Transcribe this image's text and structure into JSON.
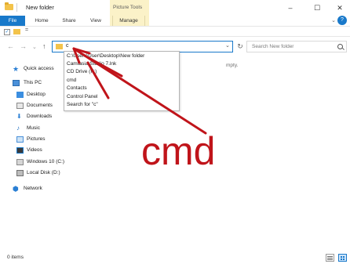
{
  "window": {
    "title": "New folder",
    "contextual_group": "Picture Tools",
    "controls": {
      "minimize": "–",
      "maximize": "☐",
      "close": "✕"
    }
  },
  "ribbon": {
    "tabs": [
      {
        "label": "File"
      },
      {
        "label": "Home"
      },
      {
        "label": "Share"
      },
      {
        "label": "View"
      },
      {
        "label": "Manage"
      }
    ],
    "expand": "⌄",
    "help": "?"
  },
  "quick_access_toolbar": {
    "dropdown": "="
  },
  "navigation": {
    "back": "←",
    "forward": "→",
    "recent": "⌄",
    "up": "↑"
  },
  "address_bar": {
    "value": "c",
    "dropdown": "⌄"
  },
  "refresh": "↻",
  "search": {
    "placeholder": "Search New folder"
  },
  "autocomplete": {
    "items": [
      "C:\\Users\\User\\Desktop\\New folder",
      "Camtasia Studio 7.lnk",
      "CD Drive (F:)",
      "cmd",
      "Contacts",
      "Control Panel",
      "Search for \"c\""
    ]
  },
  "sidebar": {
    "quick_access": "Quick access",
    "this_pc": "This PC",
    "items": [
      {
        "label": "Desktop",
        "icon": "desktop-icon"
      },
      {
        "label": "Documents",
        "icon": "documents-icon"
      },
      {
        "label": "Downloads",
        "icon": "downloads-icon"
      },
      {
        "label": "Music",
        "icon": "music-icon"
      },
      {
        "label": "Pictures",
        "icon": "pictures-icon"
      },
      {
        "label": "Videos",
        "icon": "videos-icon"
      },
      {
        "label": "Windows 10 (C:)",
        "icon": "windows-drive-icon"
      },
      {
        "label": "Local Disk (D:)",
        "icon": "local-disk-icon"
      }
    ],
    "network": "Network"
  },
  "content": {
    "empty_message": "mpty."
  },
  "status_bar": {
    "items_count": "0 items"
  },
  "annotation": {
    "text": "cmd",
    "color": "#c0141a"
  },
  "colors": {
    "accent": "#1979ca",
    "picture_tools": "#fbf2c8",
    "annotation_red": "#c0141a"
  }
}
